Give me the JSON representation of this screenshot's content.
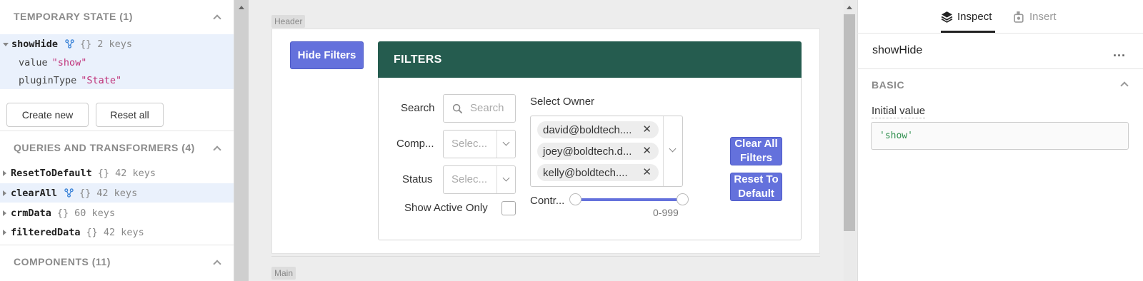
{
  "left_panel": {
    "temporary_state": {
      "title": "TEMPORARY STATE (1)",
      "item": {
        "name": "showHide",
        "braces": "{}",
        "count": "2 keys"
      },
      "props": [
        {
          "key": "value",
          "value": "\"show\""
        },
        {
          "key": "pluginType",
          "value": "\"State\""
        }
      ],
      "buttons": {
        "create_new": "Create new",
        "reset_all": "Reset all"
      }
    },
    "queries": {
      "title": "QUERIES AND TRANSFORMERS (4)",
      "items": [
        {
          "name": "ResetToDefault",
          "braces": "{}",
          "count": "42 keys"
        },
        {
          "name": "clearAll",
          "braces": "{}",
          "count": "42 keys"
        },
        {
          "name": "crmData",
          "braces": "{}",
          "count": "60 keys"
        },
        {
          "name": "filteredData",
          "braces": "{}",
          "count": "42 keys"
        }
      ]
    },
    "components": {
      "title": "COMPONENTS (11)"
    }
  },
  "canvas": {
    "header_tag": "Header",
    "main_tag": "Main",
    "hide_filters_button": "Hide Filters",
    "filters": {
      "title": "FILTERS",
      "search_label": "Search",
      "search_placeholder": "Search",
      "company_label": "Comp...",
      "company_placeholder": "Selec...",
      "status_label": "Status",
      "status_placeholder": "Selec...",
      "show_active_label": "Show Active Only",
      "owner_label": "Select Owner",
      "owners": [
        "david@boldtech....",
        "joey@boldtech.d...",
        "kelly@boldtech...."
      ],
      "contract_label": "Contr...",
      "range_text": "0-999",
      "clear_all_button": "Clear All Filters",
      "reset_default_button": "Reset To Default"
    }
  },
  "right_panel": {
    "tabs": [
      {
        "label": "Inspect",
        "icon": "layers-icon",
        "active": true
      },
      {
        "label": "Insert",
        "icon": "insert-component-icon",
        "active": false
      }
    ],
    "component_name": "showHide",
    "more_menu": "...",
    "section_title": "BASIC",
    "initial_value_label": "Initial value",
    "initial_value": "'show'"
  },
  "colors": {
    "filters_header": "#255c4f",
    "primary_button": "#6471dc",
    "highlight_row": "#eaf1fc",
    "string_value": "#c0337a"
  }
}
